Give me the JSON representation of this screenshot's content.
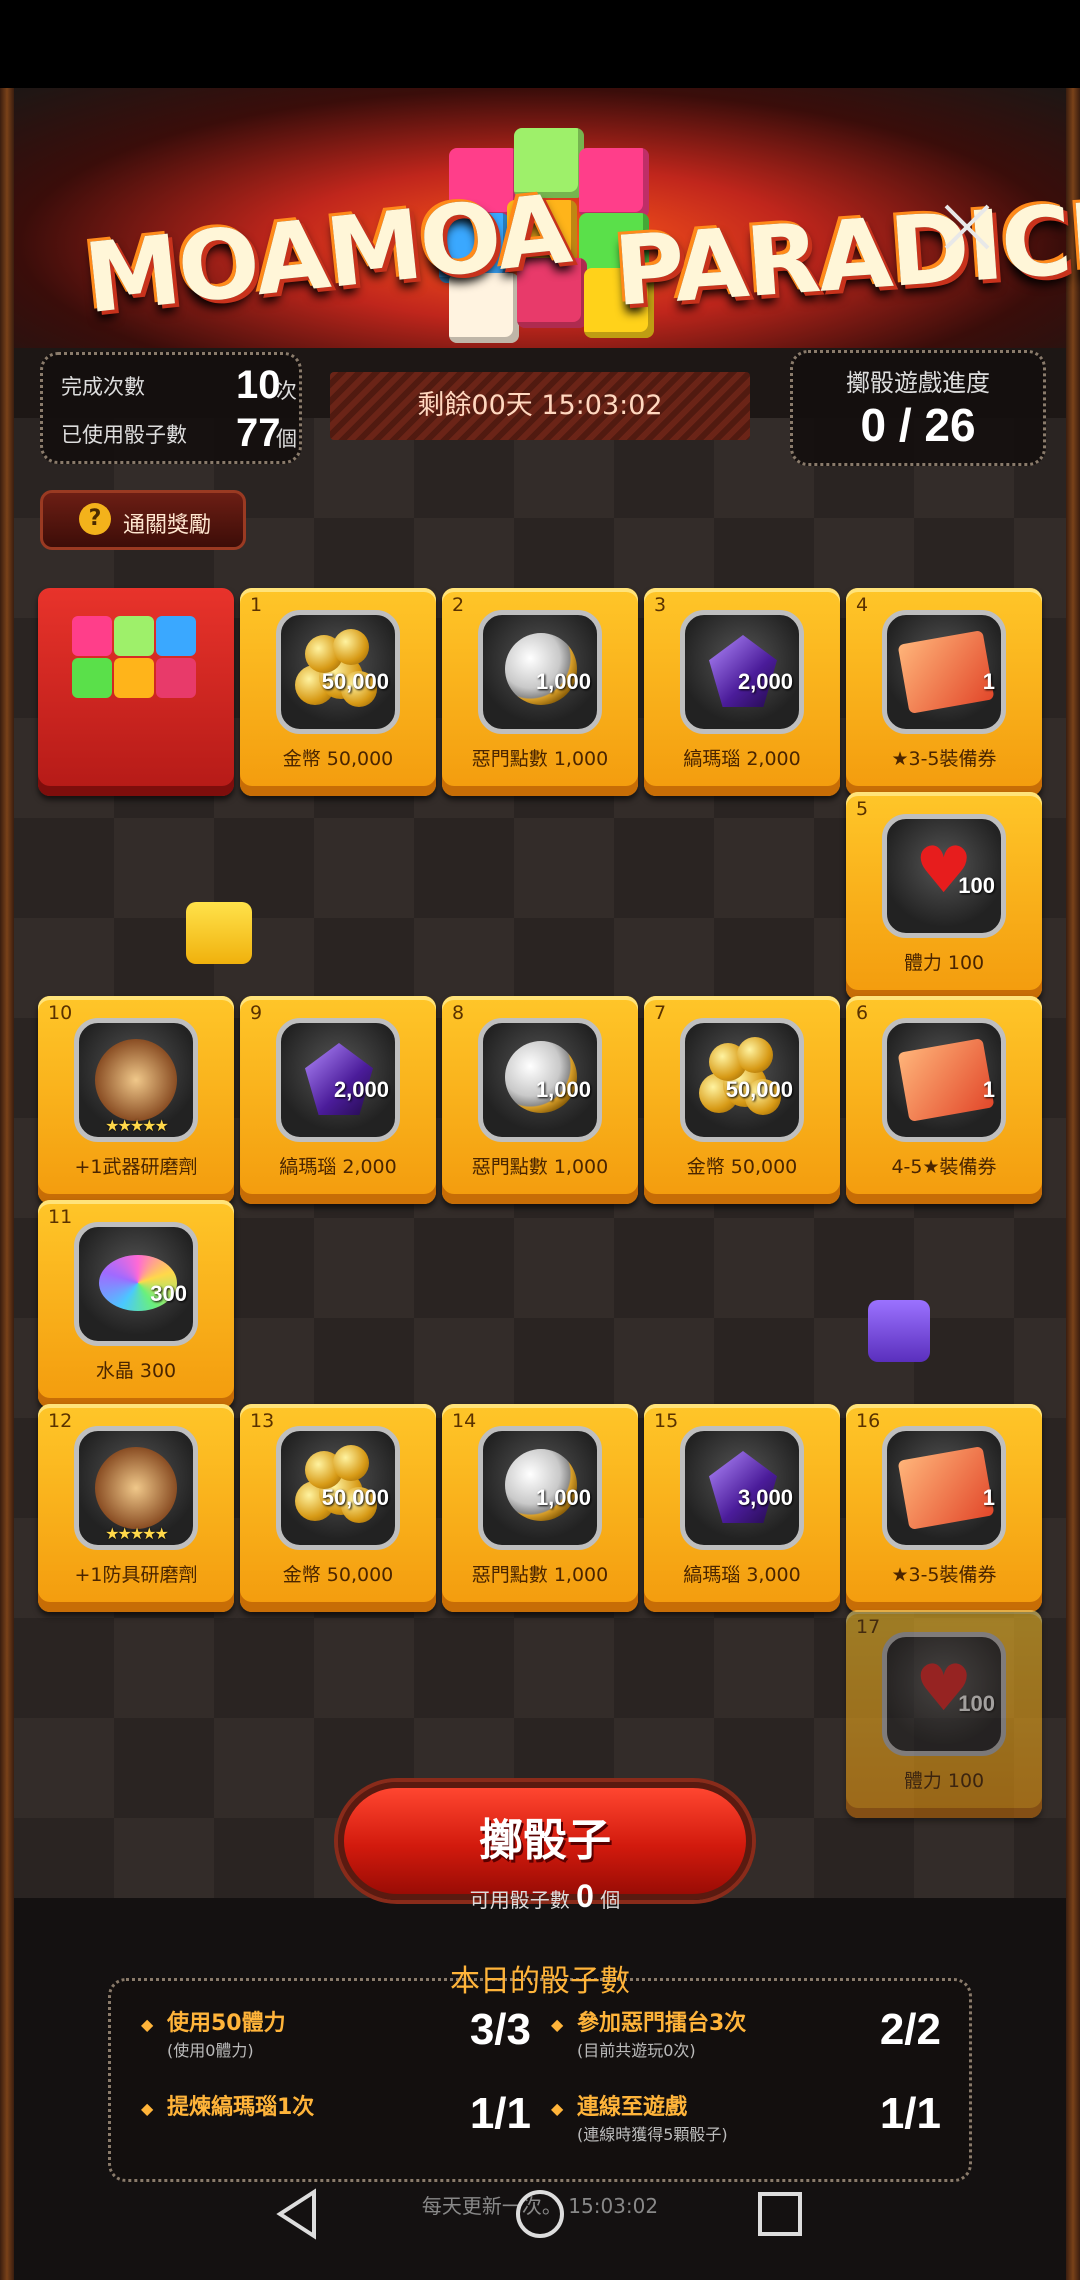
{
  "logo": {
    "left": "MOAMOA",
    "right": "PARADICE"
  },
  "stats": {
    "completed_label": "完成次數",
    "completed_value": "10",
    "completed_unit": "次",
    "used_label": "已使用骰子數",
    "used_value": "77",
    "used_unit": "個"
  },
  "timer": "剩餘00天 15:03:02",
  "progress": {
    "title": "擲骰遊戲進度",
    "value": "0 / 26"
  },
  "reward_button": {
    "icon": "question-icon",
    "icon_glyph": "?",
    "label": "通關獎勵"
  },
  "tiles": [
    {
      "index": "",
      "name": "",
      "icon": "dice-character"
    },
    {
      "index": "1",
      "name": "金幣 50,000",
      "qty": "50,000",
      "icon": "gold-coins-icon"
    },
    {
      "index": "2",
      "name": "惡門點數 1,000",
      "qty": "1,000",
      "icon": "silver-coin-icon"
    },
    {
      "index": "3",
      "name": "縞瑪瑙 2,000",
      "qty": "2,000",
      "icon": "onyx-gem-icon"
    },
    {
      "index": "4",
      "name": "★3-5裝備券",
      "qty": "1",
      "icon": "equipment-ticket-icon"
    },
    {
      "index": "5",
      "name": "體力 100",
      "qty": "100",
      "icon": "heart-icon"
    },
    {
      "index": "6",
      "name": "4-5★裝備券",
      "qty": "1",
      "icon": "equipment-ticket-icon"
    },
    {
      "index": "7",
      "name": "金幣 50,000",
      "qty": "50,000",
      "icon": "gold-coins-icon"
    },
    {
      "index": "8",
      "name": "惡門點數 1,000",
      "qty": "1,000",
      "icon": "silver-coin-icon"
    },
    {
      "index": "9",
      "name": "縞瑪瑙 2,000",
      "qty": "2,000",
      "icon": "onyx-gem-icon"
    },
    {
      "index": "10",
      "name": "+1武器研磨劑",
      "qty": "",
      "stars": "★★★★★",
      "icon": "weapon-polish-icon"
    },
    {
      "index": "11",
      "name": "水晶 300",
      "qty": "300",
      "icon": "crystal-icon"
    },
    {
      "index": "12",
      "name": "+1防具研磨劑",
      "qty": "",
      "stars": "★★★★★",
      "icon": "armor-polish-icon"
    },
    {
      "index": "13",
      "name": "金幣 50,000",
      "qty": "50,000",
      "icon": "gold-coins-icon"
    },
    {
      "index": "14",
      "name": "惡門點數 1,000",
      "qty": "1,000",
      "icon": "silver-coin-icon"
    },
    {
      "index": "15",
      "name": "縞瑪瑙 3,000",
      "qty": "3,000",
      "icon": "onyx-gem-icon"
    },
    {
      "index": "16",
      "name": "★3-5裝備券",
      "qty": "1",
      "icon": "equipment-ticket-icon"
    },
    {
      "index": "17",
      "name": "體力 100",
      "qty": "100",
      "icon": "heart-icon"
    }
  ],
  "roll": {
    "label": "擲骰子",
    "available_label": "可用骰子數",
    "available_value": "0",
    "available_unit": "個"
  },
  "daily": {
    "title": "本日的骰子數",
    "tasks": [
      {
        "title": "使用50體力",
        "sub": "(使用0體力)",
        "count": "3/3"
      },
      {
        "title": "參加惡門擂台3次",
        "sub": "(目前共遊玩0次)",
        "count": "2/2"
      },
      {
        "title": "提煉縞瑪瑙1次",
        "sub": "",
        "count": "1/1"
      },
      {
        "title": "連線至遊戲",
        "sub": "(連線時獲得5顆骰子)",
        "count": "1/1"
      }
    ]
  },
  "footer_note": "每天更新一次。 15:03:02",
  "colors": {
    "tile": "#f7b11c",
    "start_tile": "#d8261f",
    "accent": "#ffb43a",
    "roll_button": "#e2220f"
  }
}
